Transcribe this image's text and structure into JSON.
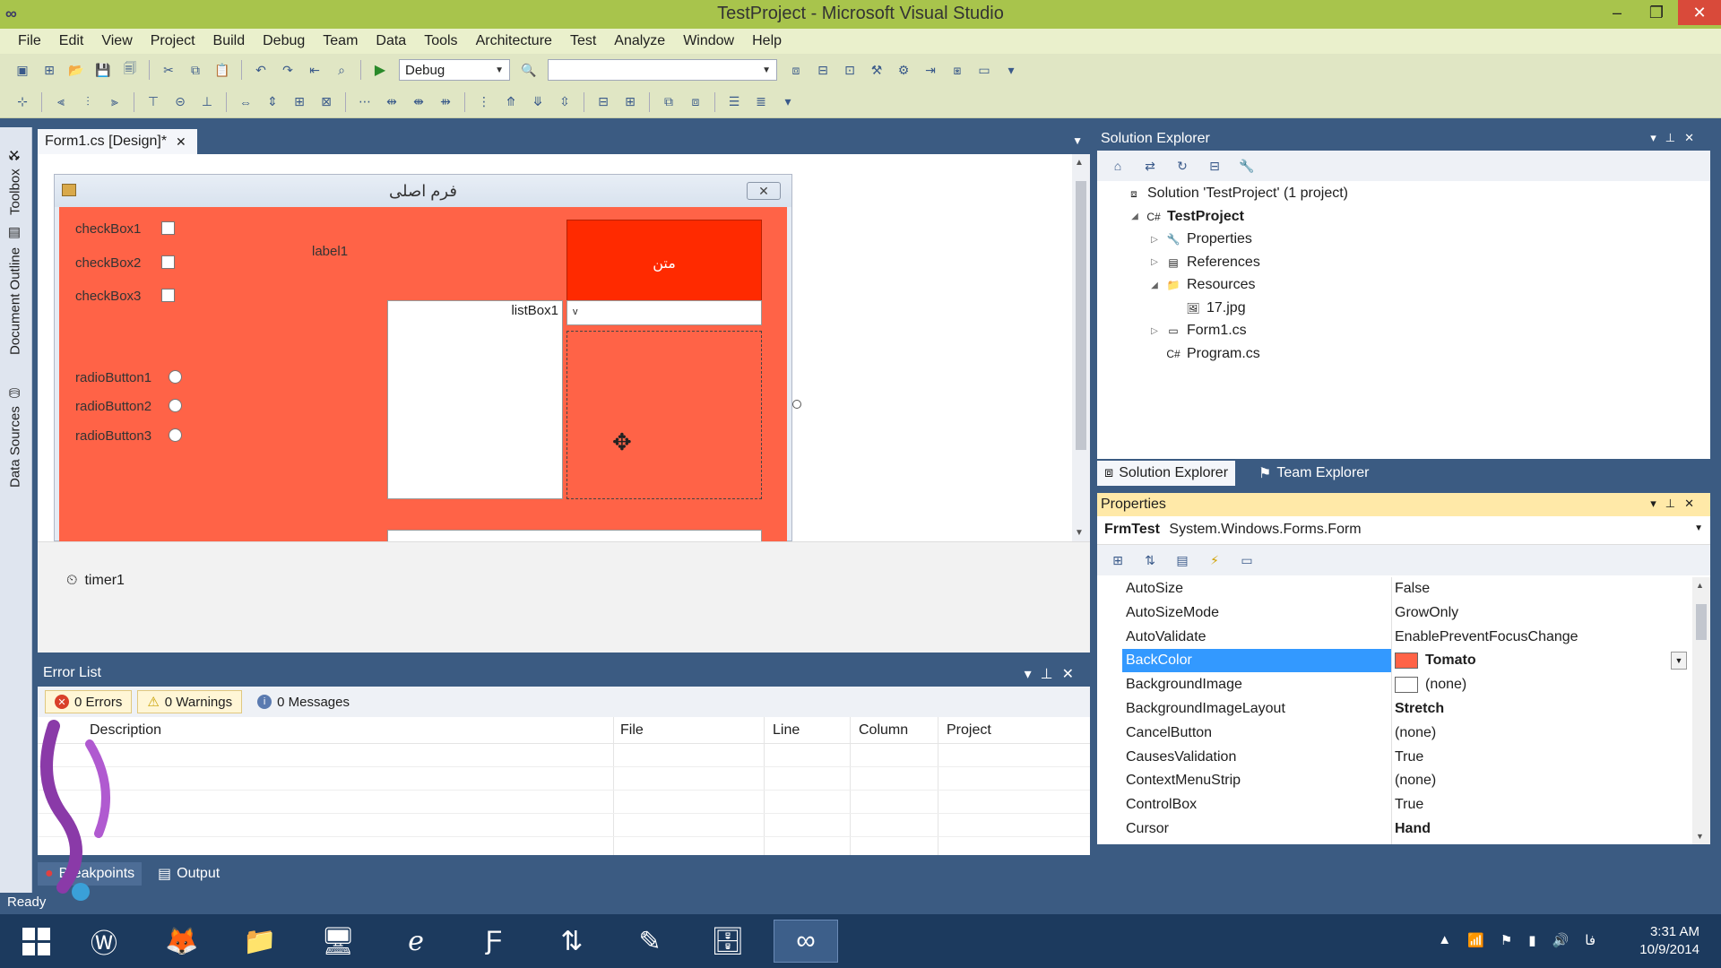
{
  "window": {
    "title": "TestProject - Microsoft Visual Studio",
    "minimize": "–",
    "restore": "❐",
    "close": "✕"
  },
  "menu": [
    "File",
    "Edit",
    "View",
    "Project",
    "Build",
    "Debug",
    "Team",
    "Data",
    "Tools",
    "Architecture",
    "Test",
    "Analyze",
    "Window",
    "Help"
  ],
  "toolbar": {
    "config_value": "Debug",
    "platform_value": ""
  },
  "left_strip": [
    "Toolbox",
    "Document Outline",
    "Data Sources"
  ],
  "document_tab": {
    "label": "Form1.cs [Design]*",
    "close": "✕",
    "dropdown": "▼"
  },
  "form": {
    "title": "فرم اصلی",
    "close": "✕",
    "back_color": "#ff6347",
    "checkboxes": [
      "checkBox1",
      "checkBox2",
      "checkBox3"
    ],
    "radios": [
      "radioButton1",
      "radioButton2",
      "radioButton3"
    ],
    "label": "label1",
    "button_text": "متن",
    "listbox": "listBox1",
    "combo_arrow": "v"
  },
  "tray": {
    "timer": "timer1"
  },
  "error_list": {
    "title": "Error List",
    "errors": "0 Errors",
    "warnings": "0 Warnings",
    "messages": "0 Messages",
    "columns": [
      "Description",
      "File",
      "Line",
      "Column",
      "Project"
    ]
  },
  "bottom_tabs": [
    "Breakpoints",
    "Output"
  ],
  "status": "Ready",
  "solution_explorer": {
    "title": "Solution Explorer",
    "items": [
      {
        "label": "Solution 'TestProject' (1 project)",
        "icon": "solution-icon",
        "level": 0,
        "expander": ""
      },
      {
        "label": "TestProject",
        "icon": "csharp-project-icon",
        "level": 1,
        "expander": "◢",
        "bold": true
      },
      {
        "label": "Properties",
        "icon": "properties-icon",
        "level": 2,
        "expander": "▷"
      },
      {
        "label": "References",
        "icon": "references-icon",
        "level": 2,
        "expander": "▷"
      },
      {
        "label": "Resources",
        "icon": "folder-icon",
        "level": 2,
        "expander": "◢"
      },
      {
        "label": "17.jpg",
        "icon": "image-file-icon",
        "level": 3,
        "expander": ""
      },
      {
        "label": "Form1.cs",
        "icon": "form-icon",
        "level": 2,
        "expander": "▷"
      },
      {
        "label": "Program.cs",
        "icon": "csharp-file-icon",
        "level": 2,
        "expander": ""
      }
    ],
    "tabs": [
      "Solution Explorer",
      "Team Explorer"
    ]
  },
  "properties": {
    "title": "Properties",
    "object_name": "FrmTest",
    "object_type": "System.Windows.Forms.Form",
    "rows": [
      {
        "name": "AutoSize",
        "value": "False"
      },
      {
        "name": "AutoSizeMode",
        "value": "GrowOnly"
      },
      {
        "name": "AutoValidate",
        "value": "EnablePreventFocusChange"
      },
      {
        "name": "BackColor",
        "value": "Tomato",
        "swatch": "#ff6347",
        "bold": true,
        "selected": true
      },
      {
        "name": "BackgroundImage",
        "value": "(none)",
        "swatch": "#ffffff"
      },
      {
        "name": "BackgroundImageLayout",
        "value": "Stretch",
        "bold": true
      },
      {
        "name": "CancelButton",
        "value": "(none)"
      },
      {
        "name": "CausesValidation",
        "value": "True"
      },
      {
        "name": "ContextMenuStrip",
        "value": "(none)"
      },
      {
        "name": "ControlBox",
        "value": "True"
      },
      {
        "name": "Cursor",
        "value": "Hand",
        "bold": true
      }
    ]
  },
  "taskbar": {
    "apps": [
      "windows-start-icon",
      "wamp-icon",
      "firefox-icon",
      "file-explorer-icon",
      "remote-desktop-icon",
      "internet-explorer-icon",
      "filezilla-icon",
      "cuteftp-icon",
      "notes-icon",
      "archive-icon",
      "visual-studio-icon"
    ],
    "time": "3:31 AM",
    "date": "10/9/2014",
    "lang": "فا"
  },
  "colors": {
    "title_bar": "#a8c44c",
    "selection": "#3399ff",
    "tomato": "#ff6347",
    "red_button": "#ff2a00"
  }
}
